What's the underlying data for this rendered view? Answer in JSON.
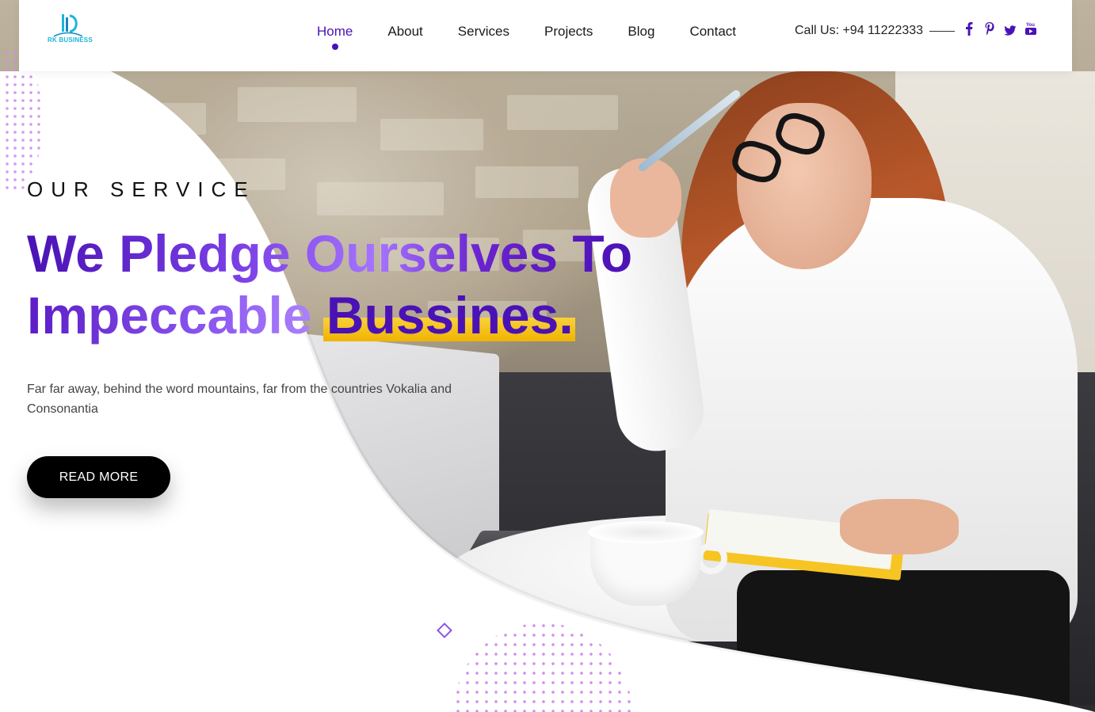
{
  "brand": {
    "logo_text": "RK BUSINESS"
  },
  "nav": {
    "items": [
      {
        "label": "Home",
        "active": true
      },
      {
        "label": "About"
      },
      {
        "label": "Services"
      },
      {
        "label": "Projects"
      },
      {
        "label": "Blog"
      },
      {
        "label": "Contact"
      }
    ]
  },
  "contact": {
    "call_text": "Call Us: +94 11222333"
  },
  "socials": [
    {
      "icon": "facebook-icon",
      "glyph": "f"
    },
    {
      "icon": "pinterest-icon",
      "glyph": "p"
    },
    {
      "icon": "twitter-icon",
      "glyph": "t"
    },
    {
      "icon": "youtube-icon",
      "glyph": "You"
    }
  ],
  "hero": {
    "eyebrow": "OUR SERVICE",
    "headline_line1": "We Pledge Ourselves To",
    "headline_line2_start": "Impeccable ",
    "headline_highlight": "Bussines.",
    "description": "Far far away, behind the word mountains, far from the countries Vokalia and Consonantia",
    "cta_label": "READ MORE"
  },
  "colors": {
    "accent": "#4a12b5",
    "highlight": "#f5c21a",
    "logo": "#18b6d8",
    "dots": "#d38cf0"
  }
}
